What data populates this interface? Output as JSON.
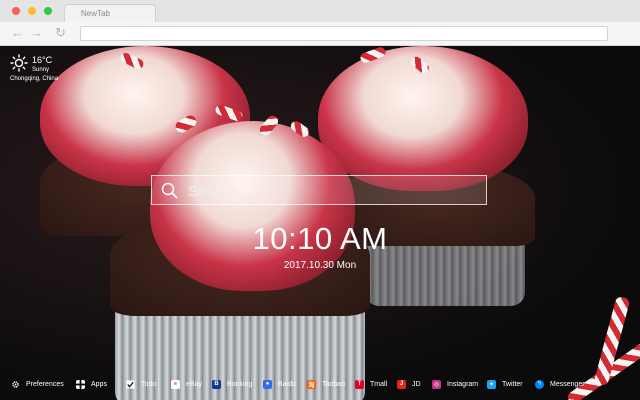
{
  "browser": {
    "tab_title": "NewTab",
    "nav_back": "←",
    "nav_forward": "→",
    "nav_reload": "↻"
  },
  "weather": {
    "temperature": "16°C",
    "condition": "Sunny",
    "location": "Chongqing,  China",
    "icon": "sun-icon"
  },
  "search": {
    "placeholder": "Search"
  },
  "clock": {
    "time": "10:10 AM",
    "date": "2017.10.30 Mon"
  },
  "bottom_bar": {
    "items": [
      {
        "label": "Preferences",
        "icon": "gear-icon",
        "color": "#ffffff"
      },
      {
        "label": "Apps",
        "icon": "grid-icon",
        "color": "#ffffff"
      },
      {
        "label": "Todo",
        "icon": "checkbox-icon",
        "color": "#ffffff"
      },
      {
        "label": "eBay",
        "icon": "ebay-icon",
        "color": "#ffffff"
      },
      {
        "label": "Booking",
        "icon": "booking-icon",
        "color": "#0b3a8f"
      },
      {
        "label": "Baidu",
        "icon": "baidu-icon",
        "color": "#2f6fe6"
      },
      {
        "label": "Taobao",
        "icon": "taobao-icon",
        "color": "#ff5a00"
      },
      {
        "label": "Tmall",
        "icon": "tmall-icon",
        "color": "#e3002b"
      },
      {
        "label": "JD",
        "icon": "jd-icon",
        "color": "#e1251b"
      },
      {
        "label": "Instagram",
        "icon": "instagram-icon",
        "color": "#c13584"
      },
      {
        "label": "Twitter",
        "icon": "twitter-icon",
        "color": "#1da1f2"
      },
      {
        "label": "Messenger",
        "icon": "messenger-icon",
        "color": "#0084ff"
      }
    ]
  }
}
